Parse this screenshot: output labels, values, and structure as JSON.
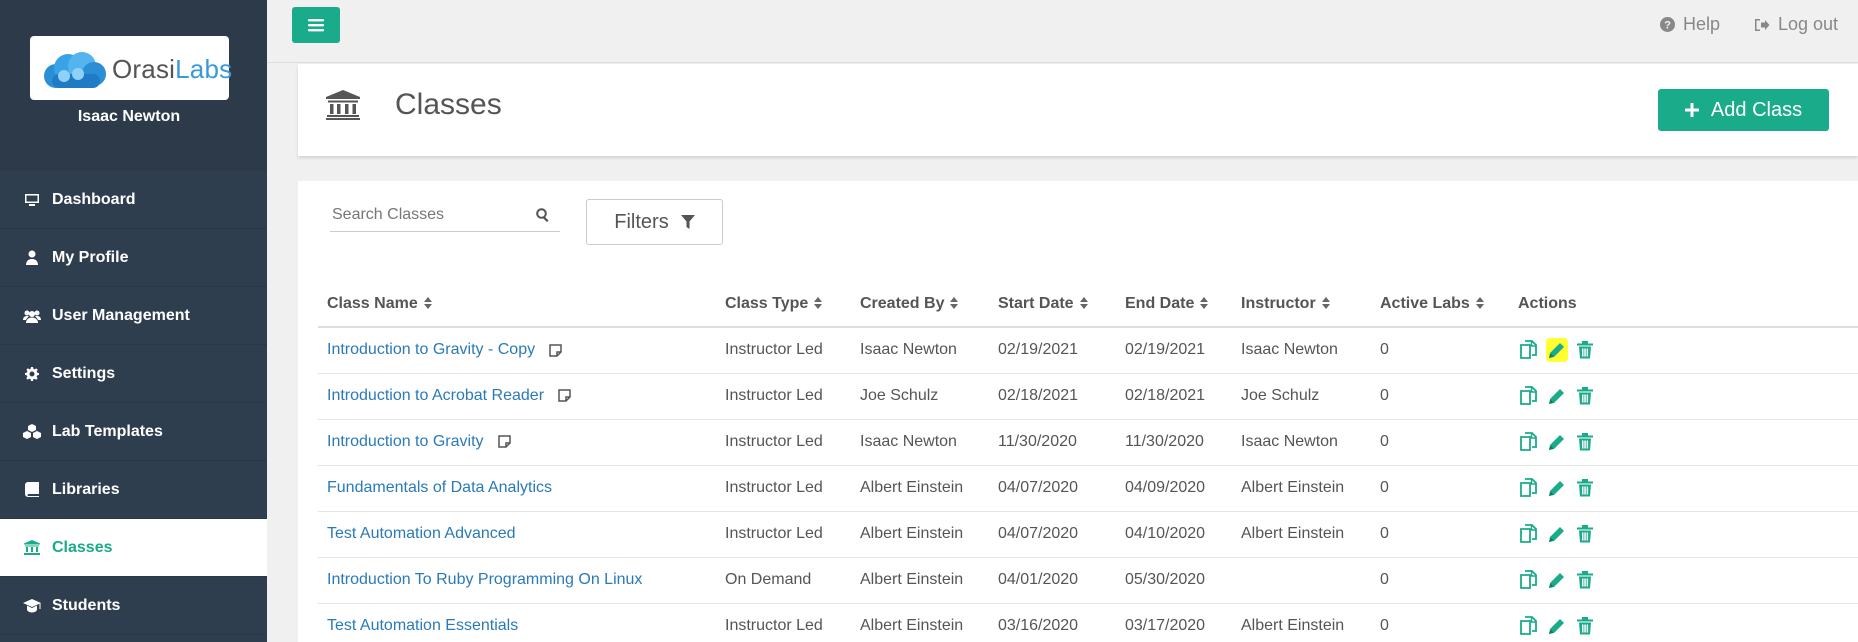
{
  "brand": {
    "name_part1": "Orasi",
    "name_part2": "Labs",
    "accent": "#1aab8a",
    "sidebar_bg": "#2f3e4e"
  },
  "user": {
    "name": "Isaac Newton"
  },
  "nav": [
    {
      "label": "Dashboard",
      "icon": "monitor-icon"
    },
    {
      "label": "My Profile",
      "icon": "user-icon"
    },
    {
      "label": "User Management",
      "icon": "users-icon"
    },
    {
      "label": "Settings",
      "icon": "gear-icon"
    },
    {
      "label": "Lab Templates",
      "icon": "cubes-icon"
    },
    {
      "label": "Libraries",
      "icon": "book-icon"
    },
    {
      "label": "Classes",
      "icon": "institution-icon",
      "active": true
    },
    {
      "label": "Students",
      "icon": "graduation-cap-icon"
    }
  ],
  "topbar": {
    "help": "Help",
    "logout": "Log out"
  },
  "header": {
    "title": "Classes",
    "add_button": "Add Class"
  },
  "search": {
    "placeholder": "Search Classes"
  },
  "filters": {
    "label": "Filters"
  },
  "table": {
    "headers": [
      "Class Name",
      "Class Type",
      "Created By",
      "Start Date",
      "End Date",
      "Instructor",
      "Active Labs",
      "Actions"
    ],
    "rows": [
      {
        "name": "Introduction to Gravity - Copy",
        "note": true,
        "type": "Instructor Led",
        "created_by": "Isaac Newton",
        "start": "02/19/2021",
        "end": "02/19/2021",
        "instructor": "Isaac Newton",
        "active_labs": "0",
        "edit_highlighted": true
      },
      {
        "name": "Introduction to Acrobat Reader",
        "note": true,
        "type": "Instructor Led",
        "created_by": "Joe Schulz",
        "start": "02/18/2021",
        "end": "02/18/2021",
        "instructor": "Joe Schulz",
        "active_labs": "0"
      },
      {
        "name": "Introduction to Gravity",
        "note": true,
        "type": "Instructor Led",
        "created_by": "Isaac Newton",
        "start": "11/30/2020",
        "end": "11/30/2020",
        "instructor": "Isaac Newton",
        "active_labs": "0"
      },
      {
        "name": "Fundamentals of Data Analytics",
        "note": false,
        "type": "Instructor Led",
        "created_by": "Albert Einstein",
        "start": "04/07/2020",
        "end": "04/09/2020",
        "instructor": "Albert Einstein",
        "active_labs": "0"
      },
      {
        "name": "Test Automation Advanced",
        "note": false,
        "type": "Instructor Led",
        "created_by": "Albert Einstein",
        "start": "04/07/2020",
        "end": "04/10/2020",
        "instructor": "Albert Einstein",
        "active_labs": "0"
      },
      {
        "name": "Introduction To Ruby Programming On Linux",
        "note": false,
        "type": "On Demand",
        "created_by": "Albert Einstein",
        "start": "04/01/2020",
        "end": "05/30/2020",
        "instructor": "",
        "active_labs": "0"
      },
      {
        "name": "Test Automation Essentials",
        "note": false,
        "type": "Instructor Led",
        "created_by": "Albert Einstein",
        "start": "03/16/2020",
        "end": "03/17/2020",
        "instructor": "Albert Einstein",
        "active_labs": "0"
      }
    ]
  }
}
